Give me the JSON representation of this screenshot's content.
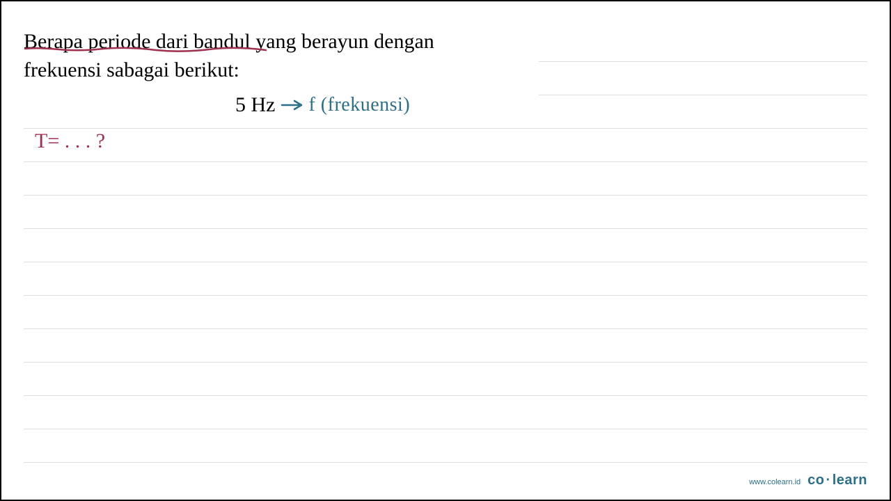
{
  "question": {
    "line1": "Berapa periode dari bandul yang berayun dengan",
    "line2": "frekuensi sabagai berikut:"
  },
  "frequency": {
    "value": "5 Hz",
    "annotation": "f (frekuensi)"
  },
  "period_prompt": "T= . . . ?",
  "footer": {
    "url": "www.colearn.id",
    "brand_part1": "co",
    "brand_dot": "·",
    "brand_part2": "learn"
  },
  "colors": {
    "underline": "#a03050",
    "annotation": "#2b6f88",
    "ruled": "#dddddd"
  }
}
